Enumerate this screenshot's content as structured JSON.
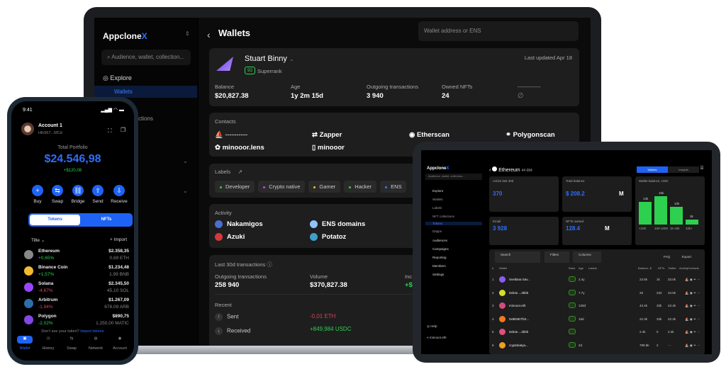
{
  "laptop": {
    "sidebar": {
      "logo": "Appclone",
      "logo_mark": "X",
      "search_placeholder": "Audience, wallet, collection...",
      "explore": "Explore",
      "items": [
        "Wallets",
        "NFT collections"
      ]
    },
    "header": {
      "title": "Wallets",
      "search_placeholder": "Wallet address or ENS"
    },
    "profile": {
      "name": "Stuart Binny",
      "rank": "92",
      "rank_label": "Superrank",
      "last_updated": "Last updated Apr 18",
      "stats": [
        {
          "label": "Balance",
          "value": "$20,827.38"
        },
        {
          "label": "Age",
          "value": "1y 2m 15d"
        },
        {
          "label": "Outgoing transactions",
          "value": "3 940"
        },
        {
          "label": "Owned NFTs",
          "value": "24"
        },
        {
          "label": "-------------",
          "value": "∅"
        }
      ]
    },
    "contacts": {
      "title": "Contacts",
      "items": [
        "----------",
        "Zapper",
        "Etherscan",
        "Polygonscan",
        "minooor.lens",
        "minooor"
      ]
    },
    "labels": {
      "title": "Labels",
      "items": [
        {
          "name": "Developer",
          "color": "#2ed04f"
        },
        {
          "name": "Crypto native",
          "color": "#b34dff"
        },
        {
          "name": "Gamer",
          "color": "#e8c52a"
        },
        {
          "name": "Hacker",
          "color": "#2ed04f"
        },
        {
          "name": "ENS",
          "color": "#3d7bff"
        }
      ]
    },
    "activity": {
      "title": "Activity",
      "items": [
        {
          "name": "Nakamigos",
          "color": "#4a6fd0"
        },
        {
          "name": "ENS domains",
          "color": "#8fc4ff"
        },
        {
          "name": "Azuki",
          "color": "#d9363e"
        },
        {
          "name": "Potatoz",
          "color": "#3ea0c8"
        }
      ]
    },
    "transactions": {
      "title": "Last 30d transactions",
      "outgoing_label": "Outgoing transactions",
      "outgoing": "258 940",
      "volume_label": "Volume",
      "volume": "$370,827.38",
      "income_label": "Inc",
      "income": "+$",
      "recent": "Recent",
      "rows": [
        {
          "type": "Sent",
          "amount": "-0,01 ETH",
          "color": "#d0455a"
        },
        {
          "type": "Received",
          "amount": "+849,984 USDC",
          "color": "#2ed04f"
        }
      ]
    }
  },
  "phone": {
    "time": "9:41",
    "account": "Account 1",
    "address": "Hfc567...5fCd",
    "portfolio_label": "Total Portfolio",
    "portfolio": "$24.546,98",
    "change": "+$120,08",
    "actions": [
      "Buy",
      "Swap",
      "Bridge",
      "Send",
      "Receive"
    ],
    "action_icons": [
      "+",
      "⇆",
      "⛓",
      "⇧",
      "⇩"
    ],
    "tabs": [
      "Tokens",
      "NFTs"
    ],
    "sort": "Title",
    "import": "Import",
    "tokens": [
      {
        "name": "Ethereum",
        "change": "+0,65%",
        "value": "$2.358,35",
        "amount": "0,69 ETH",
        "color": "#2ed04f",
        "icon": "#888"
      },
      {
        "name": "Binance Coin",
        "change": "+1,57%",
        "value": "$1.234,48",
        "amount": "1,99 BNB",
        "color": "#2ed04f",
        "icon": "#f3ba2f"
      },
      {
        "name": "Solana",
        "change": "-4,67%",
        "value": "$2.345,50",
        "amount": "45,10 SOL",
        "color": "#e0455a",
        "icon": "#9945ff"
      },
      {
        "name": "Arbitrum",
        "change": "-1,94%",
        "value": "$1.267,09",
        "amount": "678,09 ARB",
        "color": "#e0455a",
        "icon": "#2d6ea8"
      },
      {
        "name": "Polygon",
        "change": "-2,02%",
        "value": "$890,75",
        "amount": "1.250,00 MATIC",
        "color": "#2ed04f",
        "icon": "#8247e5"
      }
    ],
    "hint": "Don't see your token?",
    "hint_link": "Import tokens",
    "nav": [
      "Wallet",
      "History",
      "Swap",
      "Network",
      "Account"
    ]
  },
  "tablet": {
    "logo": "Appclone",
    "logo_mark": "X",
    "search_placeholder": "Audience, wallet, collectors...",
    "title": "Ethereum",
    "count": "44 684",
    "tabs": [
      "Wallets",
      "Insights"
    ],
    "nav": [
      "Explore",
      "Wallets",
      "Labels",
      "NFT collections",
      "Tokens",
      "Dapps",
      "Audiences",
      "Campaigns",
      "Reporting",
      "Members",
      "Settings"
    ],
    "help": "Help",
    "user": "minooor.eth",
    "stats": [
      {
        "label": "Active last 30d",
        "value": "370"
      },
      {
        "label": "Total balance",
        "value": "$ 208.2",
        "unit": "M"
      },
      {
        "label": "Email",
        "value": "3 928"
      },
      {
        "label": "NFTs owned",
        "value": "128.4",
        "unit": "M"
      }
    ],
    "chart_title": "Wallet balance, USD",
    "chart_data": {
      "type": "bar",
      "categories": [
        "<100",
        "100-1000",
        "1k-10k",
        "10k+"
      ],
      "values": [
        13,
        16,
        10,
        3
      ],
      "data_labels": [
        "13k",
        "16k",
        "10k",
        "3k"
      ]
    },
    "table": {
      "controls": [
        "Search",
        "Filters",
        "Columns",
        "FAQ",
        "Export"
      ],
      "headers": [
        "#",
        "Wallet",
        "Rank",
        "Age",
        "Labels",
        "Balance, $",
        "NFTs",
        "Twitter",
        "Activity",
        "Contacts"
      ],
      "rows": [
        {
          "n": "1",
          "wallet": "Svetlana Sav...",
          "age": "2.4y",
          "balance": "23.5k",
          "nfts": "1k",
          "twitter": "33.0k",
          "color": "#8a5cf5"
        },
        {
          "n": "2",
          "wallet": "0xb4e....3bbb",
          "age": "7.7y",
          "balance": "25",
          "nfts": "232",
          "twitter": "34.5k",
          "color": "#d6e02a"
        },
        {
          "n": "3",
          "wallet": "minooor.eth",
          "age": "128d",
          "balance": "43.4k",
          "nfts": "33k",
          "twitter": "43.4k",
          "color": "#d64a7a"
        },
        {
          "n": "4",
          "wallet": "0x9E8E7f24...",
          "age": "15d",
          "balance": "22.3k",
          "nfts": "33k",
          "twitter": "22.3k",
          "color": "#f07a1a"
        },
        {
          "n": "5",
          "wallet": "0xb4e....3bbb",
          "age": "",
          "balance": "2.4k",
          "nfts": "0",
          "twitter": "2.4k",
          "color": "#e0507a"
        },
        {
          "n": "6",
          "wallet": "cryptokatya...",
          "age": "2d",
          "balance": "789.8k",
          "nfts": "2",
          "twitter": "- -",
          "color": "#f0a020"
        }
      ]
    }
  }
}
